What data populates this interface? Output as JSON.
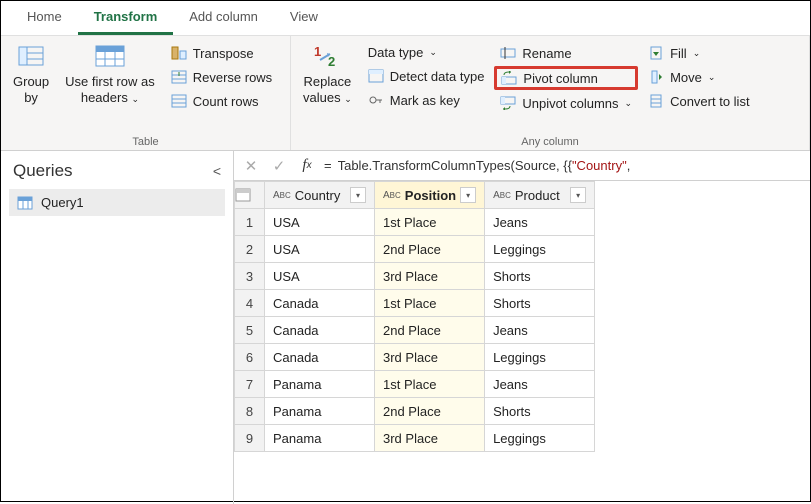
{
  "tabs": {
    "home": "Home",
    "transform": "Transform",
    "addcol": "Add column",
    "view": "View"
  },
  "ribbon": {
    "group_table": "Table",
    "group_anycol": "Any column",
    "group_by": "Group\nby",
    "first_row": "Use first row as\nheaders",
    "transpose": "Transpose",
    "reverse": "Reverse rows",
    "count": "Count rows",
    "replace": "Replace\nvalues",
    "datatype": "Data type",
    "detect": "Detect data type",
    "markkey": "Mark as key",
    "rename": "Rename",
    "pivot": "Pivot column",
    "unpivot": "Unpivot columns",
    "fill": "Fill",
    "move": "Move",
    "convert": "Convert to list"
  },
  "queries": {
    "title": "Queries",
    "item1": "Query1"
  },
  "formula": {
    "prefix": "Table.TransformColumnTypes(Source, {{",
    "str": "\"Country\"",
    "suffix": ","
  },
  "columns": {
    "c1": "Country",
    "c2": "Position",
    "c3": "Product"
  },
  "rows": [
    {
      "n": "1",
      "country": "USA",
      "position": "1st Place",
      "product": "Jeans"
    },
    {
      "n": "2",
      "country": "USA",
      "position": "2nd Place",
      "product": "Leggings"
    },
    {
      "n": "3",
      "country": "USA",
      "position": "3rd Place",
      "product": "Shorts"
    },
    {
      "n": "4",
      "country": "Canada",
      "position": "1st Place",
      "product": "Shorts"
    },
    {
      "n": "5",
      "country": "Canada",
      "position": "2nd Place",
      "product": "Jeans"
    },
    {
      "n": "6",
      "country": "Canada",
      "position": "3rd Place",
      "product": "Leggings"
    },
    {
      "n": "7",
      "country": "Panama",
      "position": "1st Place",
      "product": "Jeans"
    },
    {
      "n": "8",
      "country": "Panama",
      "position": "2nd Place",
      "product": "Shorts"
    },
    {
      "n": "9",
      "country": "Panama",
      "position": "3rd Place",
      "product": "Leggings"
    }
  ]
}
